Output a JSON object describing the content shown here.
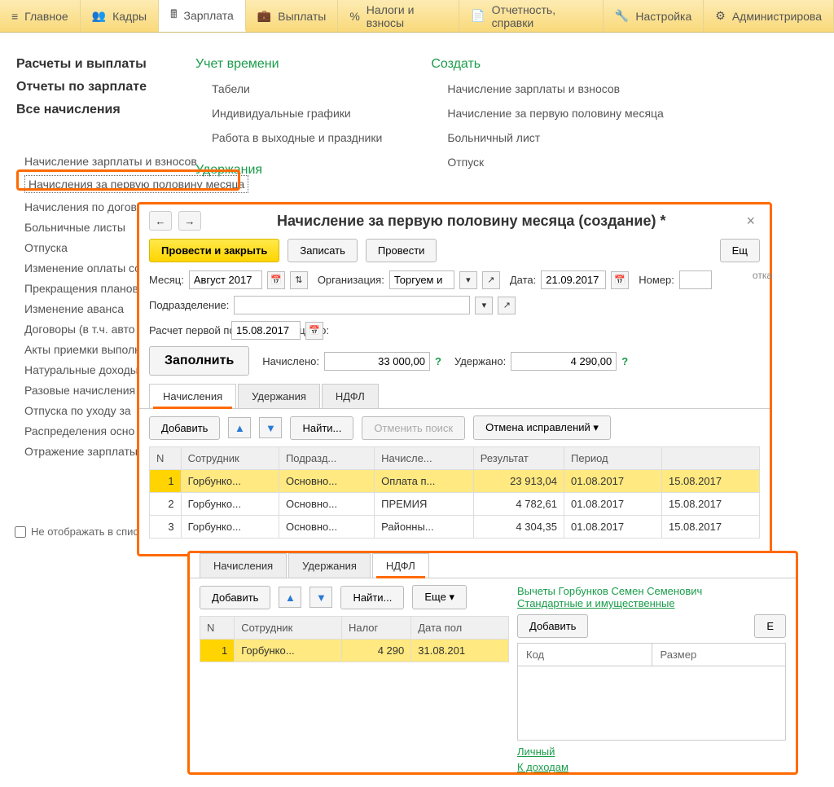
{
  "topbar": [
    {
      "label": "Главное",
      "icon": "menu"
    },
    {
      "label": "Кадры",
      "icon": "people"
    },
    {
      "label": "Зарплата",
      "icon": "calc",
      "active": true
    },
    {
      "label": "Выплаты",
      "icon": "wallet"
    },
    {
      "label": "Налоги и взносы",
      "icon": "percent"
    },
    {
      "label": "Отчетность, справки",
      "icon": "doc"
    },
    {
      "label": "Настройка",
      "icon": "wrench"
    },
    {
      "label": "Администрирова",
      "icon": "gear"
    }
  ],
  "menu": {
    "col1_h1": "Расчеты и выплаты",
    "col1_h2": "Отчеты по зарплате",
    "col1_h3": "Все начисления",
    "col2_h": "Учет времени",
    "col2_items": [
      "Табели",
      "Индивидуальные графики",
      "Работа в выходные и праздники"
    ],
    "col2_h2": "Удержания",
    "col3_h": "Создать",
    "col3_items": [
      "Начисление зарплаты и взносов",
      "Начисление за первую половину месяца",
      "Больничный лист",
      "Отпуск"
    ]
  },
  "sidebar": [
    "Начисление зарплаты и взносов",
    "Начисления за первую половину месяца",
    "Начисления по догово",
    "Больничные листы",
    "Отпуска",
    "Изменение оплаты со",
    "Прекращения планов",
    "Изменение аванса",
    "Договоры (в т.ч. авто",
    "Акты приемки выполн",
    "Натуральные доходы",
    "Разовые начисления",
    "Отпуска по уходу за",
    "Распределения осно",
    "Отражение зарплаты"
  ],
  "checkbox_label": "Не отображать в списк",
  "window1": {
    "title": "Начисление за первую половину месяца (создание) *",
    "buttons": {
      "post_close": "Провести и закрыть",
      "save": "Записать",
      "post": "Провести",
      "more": "Ещ"
    },
    "side_label": "отка",
    "month_label": "Месяц:",
    "month_value": "Август 2017",
    "org_label": "Организация:",
    "org_value": "Торгуем и",
    "date_label": "Дата:",
    "date_value": "21.09.2017",
    "num_label": "Номер:",
    "num_value": "",
    "dept_label": "Подразделение:",
    "dept_value": "",
    "calc_label": "Расчет первой половины месяца до:",
    "calc_value": "15.08.2017",
    "fill": "Заполнить",
    "accrued_label": "Начислено:",
    "accrued_value": "33 000,00",
    "withheld_label": "Удержано:",
    "withheld_value": "4 290,00",
    "tabs": [
      "Начисления",
      "Удержания",
      "НДФЛ"
    ],
    "active_tab": 0,
    "tb": {
      "add": "Добавить",
      "find": "Найти...",
      "cancel_search": "Отменить поиск",
      "cancel_fixes": "Отмена исправлений"
    },
    "columns": [
      "N",
      "Сотрудник",
      "Подразд...",
      "Начисле...",
      "Результат",
      "Период",
      ""
    ],
    "rows": [
      {
        "n": "1",
        "emp": "Горбунко...",
        "dept": "Основно...",
        "acc": "Оплата п...",
        "res": "23 913,04",
        "p1": "01.08.2017",
        "p2": "15.08.2017",
        "sel": true
      },
      {
        "n": "2",
        "emp": "Горбунко...",
        "dept": "Основно...",
        "acc": "ПРЕМИЯ",
        "res": "4 782,61",
        "p1": "01.08.2017",
        "p2": "15.08.2017"
      },
      {
        "n": "3",
        "emp": "Горбунко...",
        "dept": "Основно...",
        "acc": "Районны...",
        "res": "4 304,35",
        "p1": "01.08.2017",
        "p2": "15.08.2017"
      }
    ]
  },
  "window2": {
    "tabs": [
      "Начисления",
      "Удержания",
      "НДФЛ"
    ],
    "active_tab": 2,
    "tb": {
      "add": "Добавить",
      "find": "Найти...",
      "more": "Еще"
    },
    "columns": [
      "N",
      "Сотрудник",
      "Налог",
      "Дата пол"
    ],
    "rows": [
      {
        "n": "1",
        "emp": "Горбунко...",
        "tax": "4 290",
        "date": "31.08.201",
        "sel": true
      }
    ],
    "right": {
      "title": "Вычеты Горбунков Семен Семенович",
      "link1": "Стандартные и имущественные",
      "add": "Добавить",
      "more": "Е",
      "cols": [
        "Код",
        "Размер"
      ],
      "link2": "Личный",
      "link3": "К доходам"
    }
  }
}
